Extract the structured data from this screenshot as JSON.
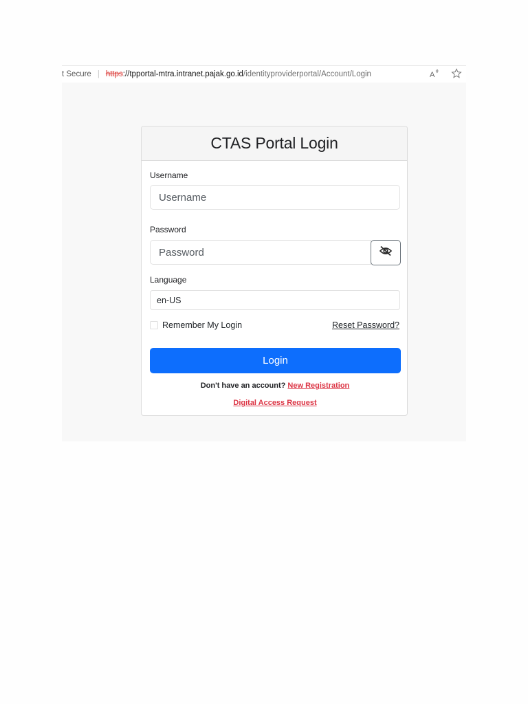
{
  "browser": {
    "security_label": "t Secure",
    "url_scheme": "https",
    "url_scheme_rest": "://",
    "url_host": "tpportal-mtra.intranet.pajak.go.id",
    "url_path": "/identityproviderportal/Account/Login",
    "icons": [
      "read-aloud-icon",
      "favorite-star-icon"
    ]
  },
  "login_card": {
    "title": "CTAS Portal Login",
    "username": {
      "label": "Username",
      "placeholder": "Username",
      "value": ""
    },
    "password": {
      "label": "Password",
      "placeholder": "Password",
      "value": "",
      "toggle_icon": "eye-slash-icon"
    },
    "language": {
      "label": "Language",
      "selected": "en-US"
    },
    "remember_label": "Remember My Login",
    "remember_checked": false,
    "reset_password_link": "Reset Password?",
    "login_button": "Login",
    "no_account_text": "Don't have an account?",
    "new_registration_link": "New Registration",
    "digital_access_link": "Digital Access Request"
  },
  "colors": {
    "primary_button": "#0d6efd",
    "link_red": "#dc3545",
    "url_scheme_red": "#d9302c"
  }
}
